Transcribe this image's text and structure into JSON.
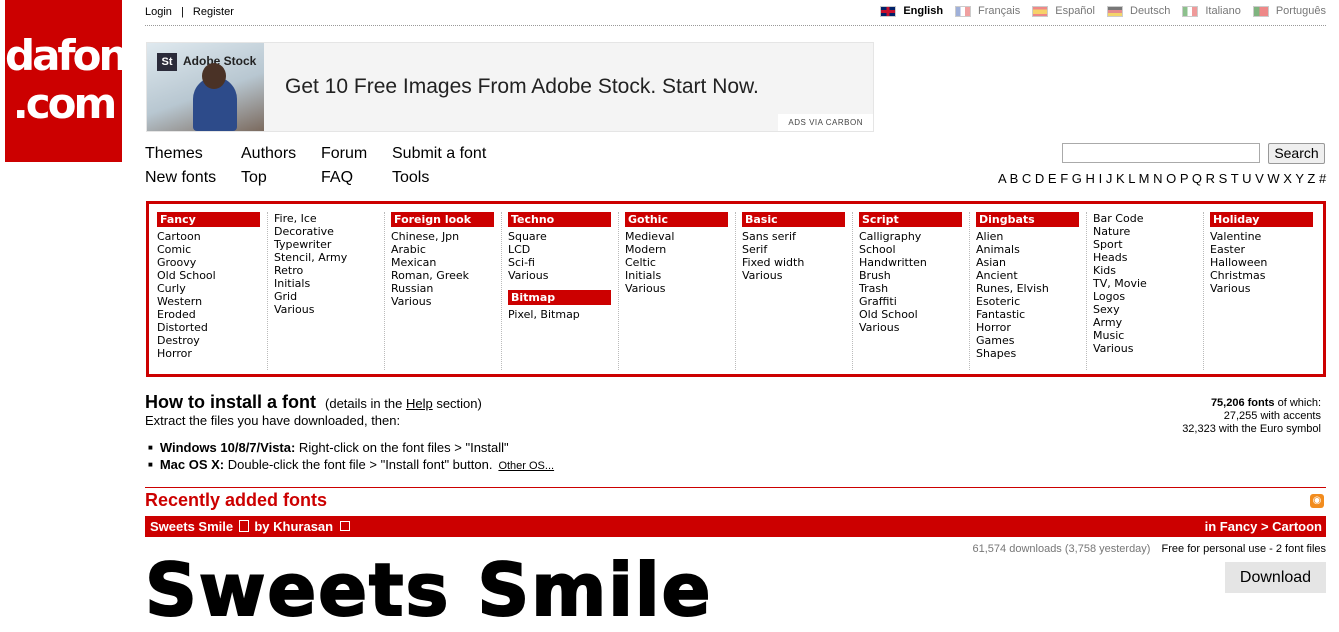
{
  "logo": {
    "line1": "dafont",
    "line2": ".com"
  },
  "auth": {
    "login": "Login",
    "separator": "|",
    "register": "Register"
  },
  "languages": [
    {
      "label": "English",
      "icon": "uk-flag-icon",
      "active": true
    },
    {
      "label": "Français",
      "icon": "fr-flag-icon",
      "active": false
    },
    {
      "label": "Español",
      "icon": "es-flag-icon",
      "active": false
    },
    {
      "label": "Deutsch",
      "icon": "de-flag-icon",
      "active": false
    },
    {
      "label": "Italiano",
      "icon": "it-flag-icon",
      "active": false
    },
    {
      "label": "Português",
      "icon": "pt-flag-icon",
      "active": false
    }
  ],
  "ad": {
    "badge": "St",
    "brand": "Adobe Stock",
    "text": "Get 10 Free Images From Adobe Stock. Start Now.",
    "via": "ADS VIA CARBON"
  },
  "nav": {
    "themes": "Themes",
    "new_fonts": "New fonts",
    "authors": "Authors",
    "top": "Top",
    "forum": "Forum",
    "faq": "FAQ",
    "submit": "Submit a font",
    "tools": "Tools"
  },
  "search": {
    "placeholder": "",
    "button": "Search"
  },
  "alphabet": [
    "A",
    "B",
    "C",
    "D",
    "E",
    "F",
    "G",
    "H",
    "I",
    "J",
    "K",
    "L",
    "M",
    "N",
    "O",
    "P",
    "Q",
    "R",
    "S",
    "T",
    "U",
    "V",
    "W",
    "X",
    "Y",
    "Z",
    "#"
  ],
  "categories": [
    {
      "head": "Fancy",
      "items": [
        "Cartoon",
        "Comic",
        "Groovy",
        "Old School",
        "Curly",
        "Western",
        "Eroded",
        "Distorted",
        "Destroy",
        "Horror"
      ]
    },
    {
      "head": "",
      "items": [
        "Fire, Ice",
        "Decorative",
        "Typewriter",
        "Stencil, Army",
        "Retro",
        "Initials",
        "Grid",
        "Various"
      ]
    },
    {
      "head": "Foreign look",
      "items": [
        "Chinese, Jpn",
        "Arabic",
        "Mexican",
        "Roman, Greek",
        "Russian",
        "Various"
      ]
    },
    {
      "head": "Techno",
      "items": [
        "Square",
        "LCD",
        "Sci-fi",
        "Various"
      ],
      "head2": "Bitmap",
      "items2": [
        "Pixel, Bitmap"
      ]
    },
    {
      "head": "Gothic",
      "items": [
        "Medieval",
        "Modern",
        "Celtic",
        "Initials",
        "Various"
      ]
    },
    {
      "head": "Basic",
      "items": [
        "Sans serif",
        "Serif",
        "Fixed width",
        "Various"
      ]
    },
    {
      "head": "Script",
      "items": [
        "Calligraphy",
        "School",
        "Handwritten",
        "Brush",
        "Trash",
        "Graffiti",
        "Old School",
        "Various"
      ]
    },
    {
      "head": "Dingbats",
      "items": [
        "Alien",
        "Animals",
        "Asian",
        "Ancient",
        "Runes, Elvish",
        "Esoteric",
        "Fantastic",
        "Horror",
        "Games",
        "Shapes"
      ]
    },
    {
      "head": "",
      "items": [
        "Bar Code",
        "Nature",
        "Sport",
        "Heads",
        "Kids",
        "TV, Movie",
        "Logos",
        "Sexy",
        "Army",
        "Music",
        "Various"
      ]
    },
    {
      "head": "Holiday",
      "items": [
        "Valentine",
        "Easter",
        "Halloween",
        "Christmas",
        "Various"
      ]
    }
  ],
  "install": {
    "title": "How to install a font",
    "details_pre": "(details in the ",
    "details_link": "Help",
    "details_post": " section)",
    "subtitle": "Extract the files you have downloaded, then:",
    "windows_label": "Windows 10/8/7/Vista:",
    "windows_text": " Right-click on the font files > \"Install\"",
    "mac_label": "Mac OS X:",
    "mac_text": " Double-click the font file > \"Install font\" button.",
    "other_os": "Other OS..."
  },
  "stats": {
    "fonts_count": "75,206 fonts",
    "fonts_suffix": " of which:",
    "accents": "27,255 with accents",
    "euro": "32,323 with the Euro symbol"
  },
  "recent": {
    "title": "Recently added fonts"
  },
  "font_entry": {
    "name": "Sweets Smile",
    "by": "by Khurasan",
    "category": "in Fancy > Cartoon",
    "downloads": "61,574 downloads (3,758 yesterday)",
    "license": "Free for personal use - 2 font files",
    "download_button": "Download",
    "preview": "Sweets Smile"
  },
  "colors": {
    "brand_red": "#cc0000",
    "rss_orange": "#f28c1e"
  }
}
